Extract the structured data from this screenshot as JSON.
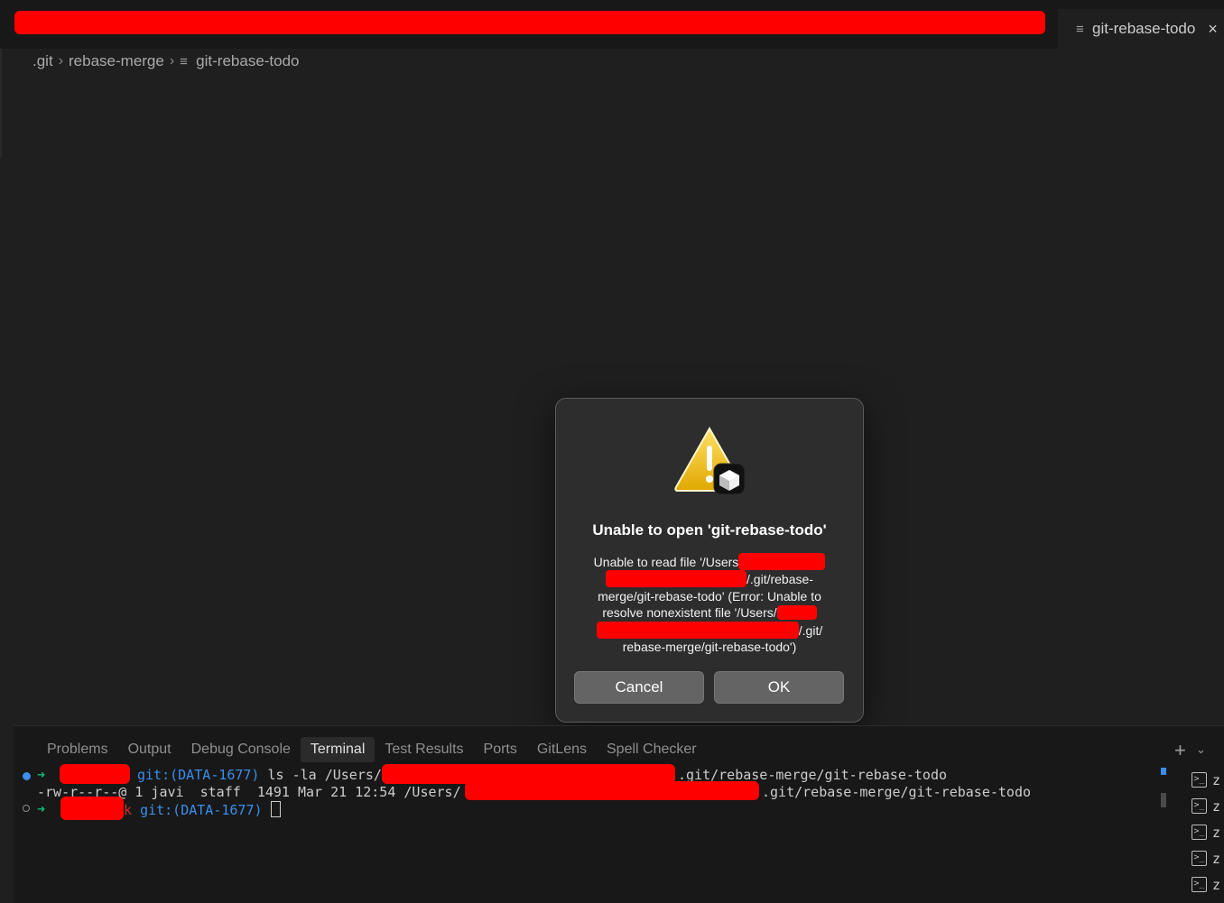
{
  "tabs": {
    "active_tab": {
      "label": "git-rebase-todo",
      "icon": "file-lines-icon",
      "close": "close-icon"
    }
  },
  "breadcrumb": {
    "items": [
      ".git",
      "rebase-merge",
      "git-rebase-todo"
    ]
  },
  "dialog": {
    "title": "Unable to open 'git-rebase-todo'",
    "message_parts": [
      "Unable to read file '/Users",
      "/.git/rebase-",
      "merge/git-rebase-todo' (Error: Unable to",
      "resolve nonexistent file '/Users/",
      "/.git/",
      "rebase-merge/git-rebase-todo')"
    ],
    "cancel_label": "Cancel",
    "ok_label": "OK",
    "icon": "warning-triangle-icon"
  },
  "panel": {
    "tabs": [
      "Problems",
      "Output",
      "Debug Console",
      "Terminal",
      "Test Results",
      "Ports",
      "GitLens",
      "Spell Checker"
    ],
    "active_tab": "Terminal"
  },
  "terminal": {
    "prompt_arrow": "➜",
    "branch": "git:(DATA-1677)",
    "line1_cmd": "ls -la /Users/",
    "line1_tail": ".git/rebase-merge/git-rebase-todo",
    "line2_head": "-rw-r--r--@ 1 javi  staff  1491 Mar 21 12:54 /Users/",
    "line2_tail": ".git/rebase-merge/git-rebase-todo",
    "line3_k": "k"
  },
  "terminal_list": {
    "items": [
      "z",
      "z",
      "z",
      "z",
      "z"
    ]
  },
  "colors": {
    "editor_bg": "#1f1f1f",
    "redaction": "#ff0000",
    "branch_blue": "#3b8eea",
    "branch_red": "#cd3131",
    "arrow_green": "#0dbc79"
  }
}
